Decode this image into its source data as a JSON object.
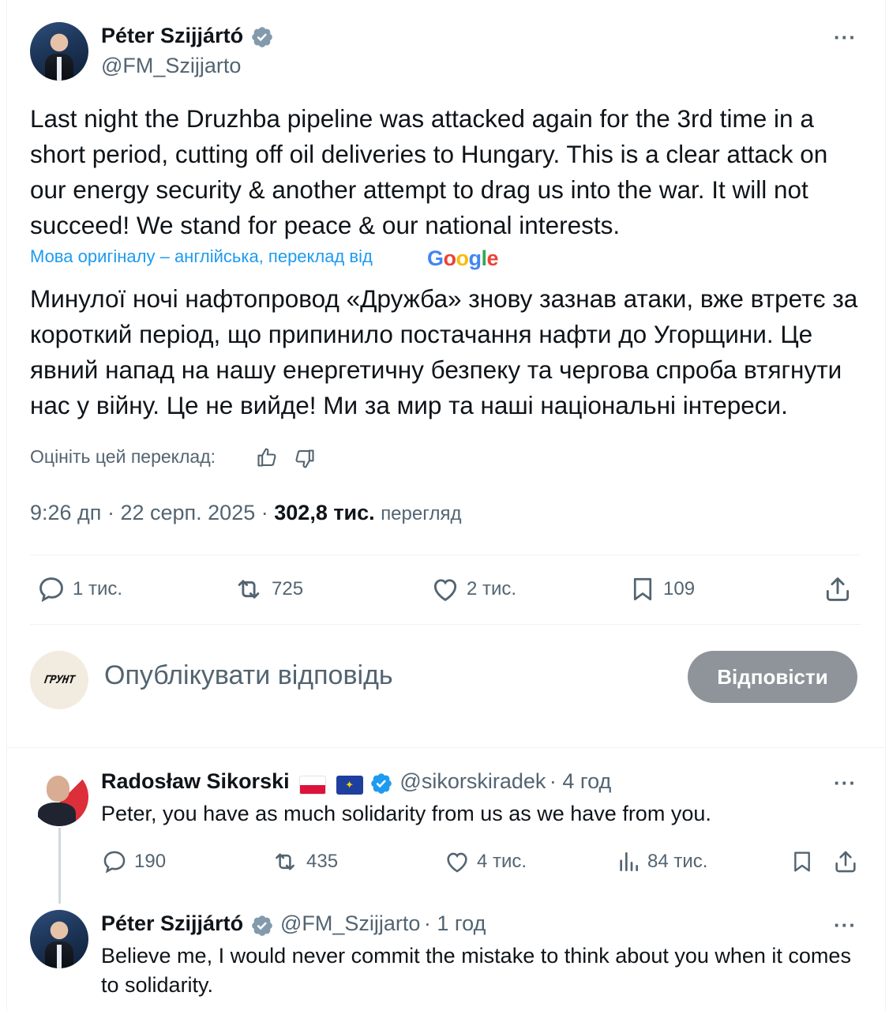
{
  "main_tweet": {
    "author_name": "Péter Szijjártó",
    "author_handle": "@FM_Szijjarto",
    "more_label": "···",
    "text": "Last night the Druzhba pipeline was attacked again for the 3rd time in a short period, cutting off oil deliveries to Hungary. This is a clear attack on our energy security & another attempt to drag us into the war. It will not succeed! We stand for peace & our national interests.",
    "translation_notice": "Мова оригіналу – англійська, переклад від",
    "translation_provider": "Google",
    "translated_text": "Минулої ночі нафтопровод «Дружба» знову зазнав атаки, вже втретє за короткий період, що припинило постачання нафти до Угорщини. Це явний напад на нашу енергетичну безпеку та чергова спроба втягнути нас у війну. Це не вийде! Ми за мир та наші національні інтереси.",
    "rate_translation": "Оцініть цей переклад:",
    "time": "9:26 дп",
    "date": "22 серп. 2025",
    "views_count": "302,8 тис.",
    "views_label": "перегляд",
    "separator": "·",
    "replies": "1 тис.",
    "reposts": "725",
    "likes": "2 тис.",
    "bookmarks": "109"
  },
  "compose": {
    "avatar_text": "ГРУНТ",
    "placeholder": "Опублікувати відповідь",
    "reply_button": "Відповісти"
  },
  "replies": [
    {
      "author_name": "Radosław Sikorski",
      "author_handle": "@sikorskiradek",
      "time": "· 4 год",
      "text": "Peter, you have as much solidarity from us as we have from you.",
      "replies": "190",
      "reposts": "435",
      "likes": "4 тис.",
      "views": "84 тис."
    },
    {
      "author_name": "Péter Szijjártó",
      "author_handle": "@FM_Szijjarto",
      "time": "· 1 год",
      "text": "Believe me, I would never commit the mistake to think about you when it comes to solidarity."
    }
  ],
  "colors": {
    "text": "#0f1419",
    "secondary": "#536471",
    "link": "#1d9bf0",
    "verified": "#829aab",
    "verified_blue": "#1d9bf0",
    "reply_button_bg": "#8e9499"
  }
}
